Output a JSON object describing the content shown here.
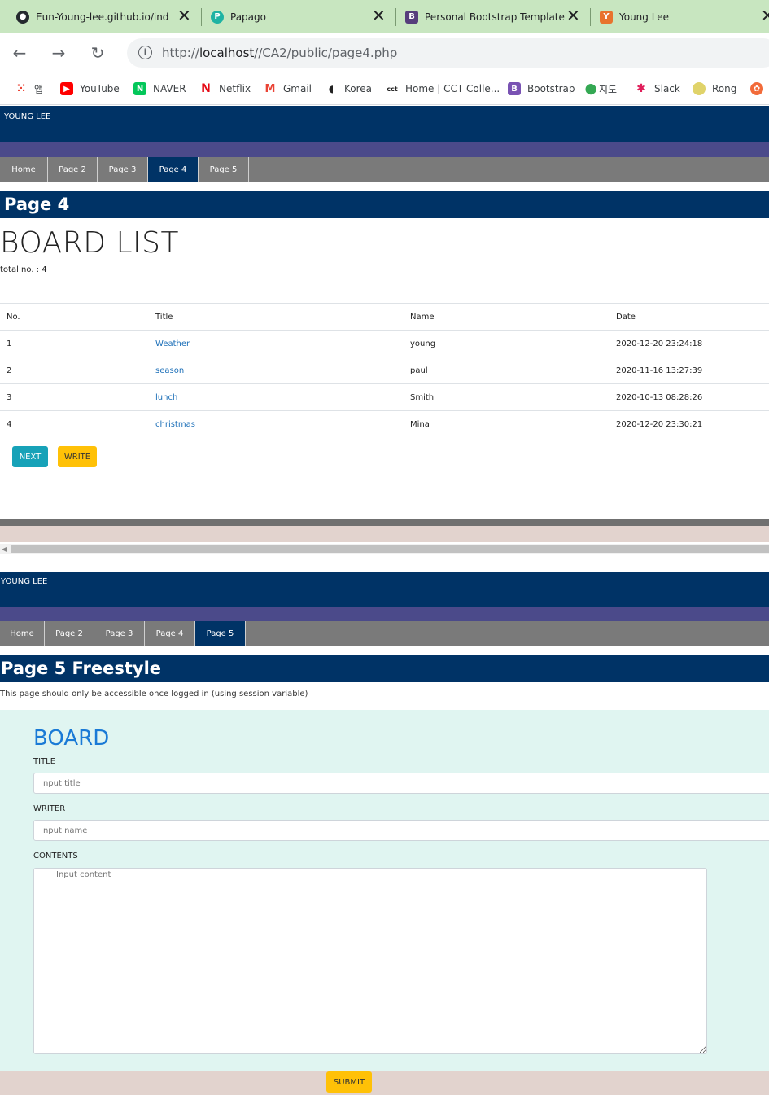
{
  "browser": {
    "tabs": [
      {
        "title": "Eun-Young-lee.github.io/index",
        "icon": "github-icon"
      },
      {
        "title": "Papago",
        "icon": "papago-icon"
      },
      {
        "title": "Personal Bootstrap Template",
        "icon": "bootstrap-icon"
      },
      {
        "title": "Young Lee",
        "icon": "site-icon"
      }
    ],
    "url_prefix": "http://",
    "url_host": "localhost",
    "url_path": "//CA2/public/page4.php",
    "bookmarks": [
      {
        "label": "앱",
        "icon": "apps-grid-icon"
      },
      {
        "label": "YouTube",
        "icon": "youtube-icon"
      },
      {
        "label": "NAVER",
        "icon": "naver-icon"
      },
      {
        "label": "Netflix",
        "icon": "netflix-icon"
      },
      {
        "label": "Gmail",
        "icon": "gmail-icon"
      },
      {
        "label": "Korea",
        "icon": "korea-icon"
      },
      {
        "label": "Home | CCT Colle...",
        "icon": "cct-icon"
      },
      {
        "label": "Bootstrap",
        "icon": "bootstrap-icon"
      },
      {
        "label": "지도",
        "icon": "map-pin-icon"
      },
      {
        "label": "Slack",
        "icon": "slack-icon"
      },
      {
        "label": "Rong",
        "icon": "rong-icon"
      }
    ]
  },
  "page4": {
    "site_name": "YOUNG LEE",
    "nav": [
      "Home",
      "Page 2",
      "Page 3",
      "Page 4",
      "Page 5"
    ],
    "active_nav": "Page 4",
    "page_title": "Page 4",
    "heading": "BOARD LIST",
    "total_text": "total no. : 4",
    "table": {
      "headers": [
        "No.",
        "Title",
        "Name",
        "Date"
      ],
      "rows": [
        [
          "1",
          "Weather",
          "young",
          "2020-12-20 23:24:18"
        ],
        [
          "2",
          "season",
          "paul",
          "2020-11-16 13:27:39"
        ],
        [
          "3",
          "lunch",
          "Smith",
          "2020-10-13 08:28:26"
        ],
        [
          "4",
          "christmas",
          "Mina",
          "2020-12-20 23:30:21"
        ]
      ]
    },
    "next_label": "NEXT",
    "write_label": "WRITE"
  },
  "page5": {
    "site_name": "YOUNG LEE",
    "nav": [
      "Home",
      "Page 2",
      "Page 3",
      "Page 4",
      "Page 5"
    ],
    "active_nav": "Page 5",
    "page_title": "Page 5 Freestyle",
    "subtext": "This page should only be accessible once logged in (using session variable)",
    "board_title": "BOARD",
    "title_label": "TITLE",
    "title_placeholder": "Input title",
    "writer_label": "WRITER",
    "writer_placeholder": "Input name",
    "contents_label": "CONTENTS",
    "contents_placeholder": "Input content",
    "submit_label": "SUBMIT"
  },
  "colors": {
    "navy": "#003366",
    "purple_band": "#4b4a8a",
    "nav_gray": "#7a7a7a",
    "link_blue": "#1c6fb8",
    "info": "#17a2b8",
    "warning": "#ffc107",
    "board_bg": "#e0f5f1",
    "board_title": "#1a7ad6"
  }
}
